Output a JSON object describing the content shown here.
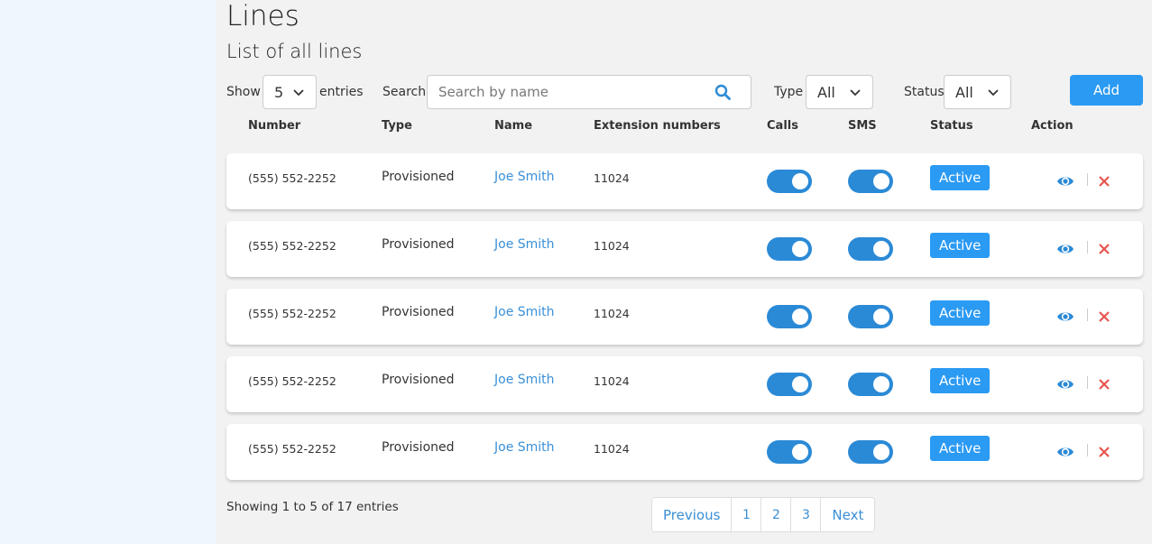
{
  "header": {
    "title": "Lines",
    "subtitle": "List of all lines"
  },
  "toolbar": {
    "show_label": "Show",
    "show_value": "5",
    "entries_label": "entries",
    "search_label": "Search",
    "search_placeholder": "Search by name",
    "type_label": "Type",
    "type_value": "All",
    "status_label": "Status",
    "status_value": "All",
    "add_label": "Add"
  },
  "table": {
    "columns": [
      "Number",
      "Type",
      "Name",
      "Extension numbers",
      "Calls",
      "SMS",
      "Status",
      "Action"
    ],
    "rows": [
      {
        "number": "(555) 552-2252",
        "type": "Provisioned",
        "name": "Joe Smith",
        "extension": "11024",
        "calls_on": true,
        "sms_on": true,
        "status": "Active"
      },
      {
        "number": "(555) 552-2252",
        "type": "Provisioned",
        "name": "Joe Smith",
        "extension": "11024",
        "calls_on": true,
        "sms_on": true,
        "status": "Active"
      },
      {
        "number": "(555) 552-2252",
        "type": "Provisioned",
        "name": "Joe Smith",
        "extension": "11024",
        "calls_on": true,
        "sms_on": true,
        "status": "Active"
      },
      {
        "number": "(555) 552-2252",
        "type": "Provisioned",
        "name": "Joe Smith",
        "extension": "11024",
        "calls_on": true,
        "sms_on": true,
        "status": "Active"
      },
      {
        "number": "(555) 552-2252",
        "type": "Provisioned",
        "name": "Joe Smith",
        "extension": "11024",
        "calls_on": true,
        "sms_on": true,
        "status": "Active"
      }
    ]
  },
  "footer": {
    "entries_info": "Showing 1 to 5 of 17 entries",
    "pagination": {
      "previous": "Previous",
      "pages": [
        "1",
        "2",
        "3"
      ],
      "next": "Next"
    }
  },
  "icons": {
    "search": "search-icon",
    "chevron": "chevron-down-icon",
    "view": "eye-icon",
    "delete": "close-icon"
  },
  "colors": {
    "accent": "#2b9af3",
    "toggle": "#2b8ad6",
    "link": "#3a8fd6",
    "delete": "#e8544f",
    "sidebar": "#eef7fd"
  }
}
